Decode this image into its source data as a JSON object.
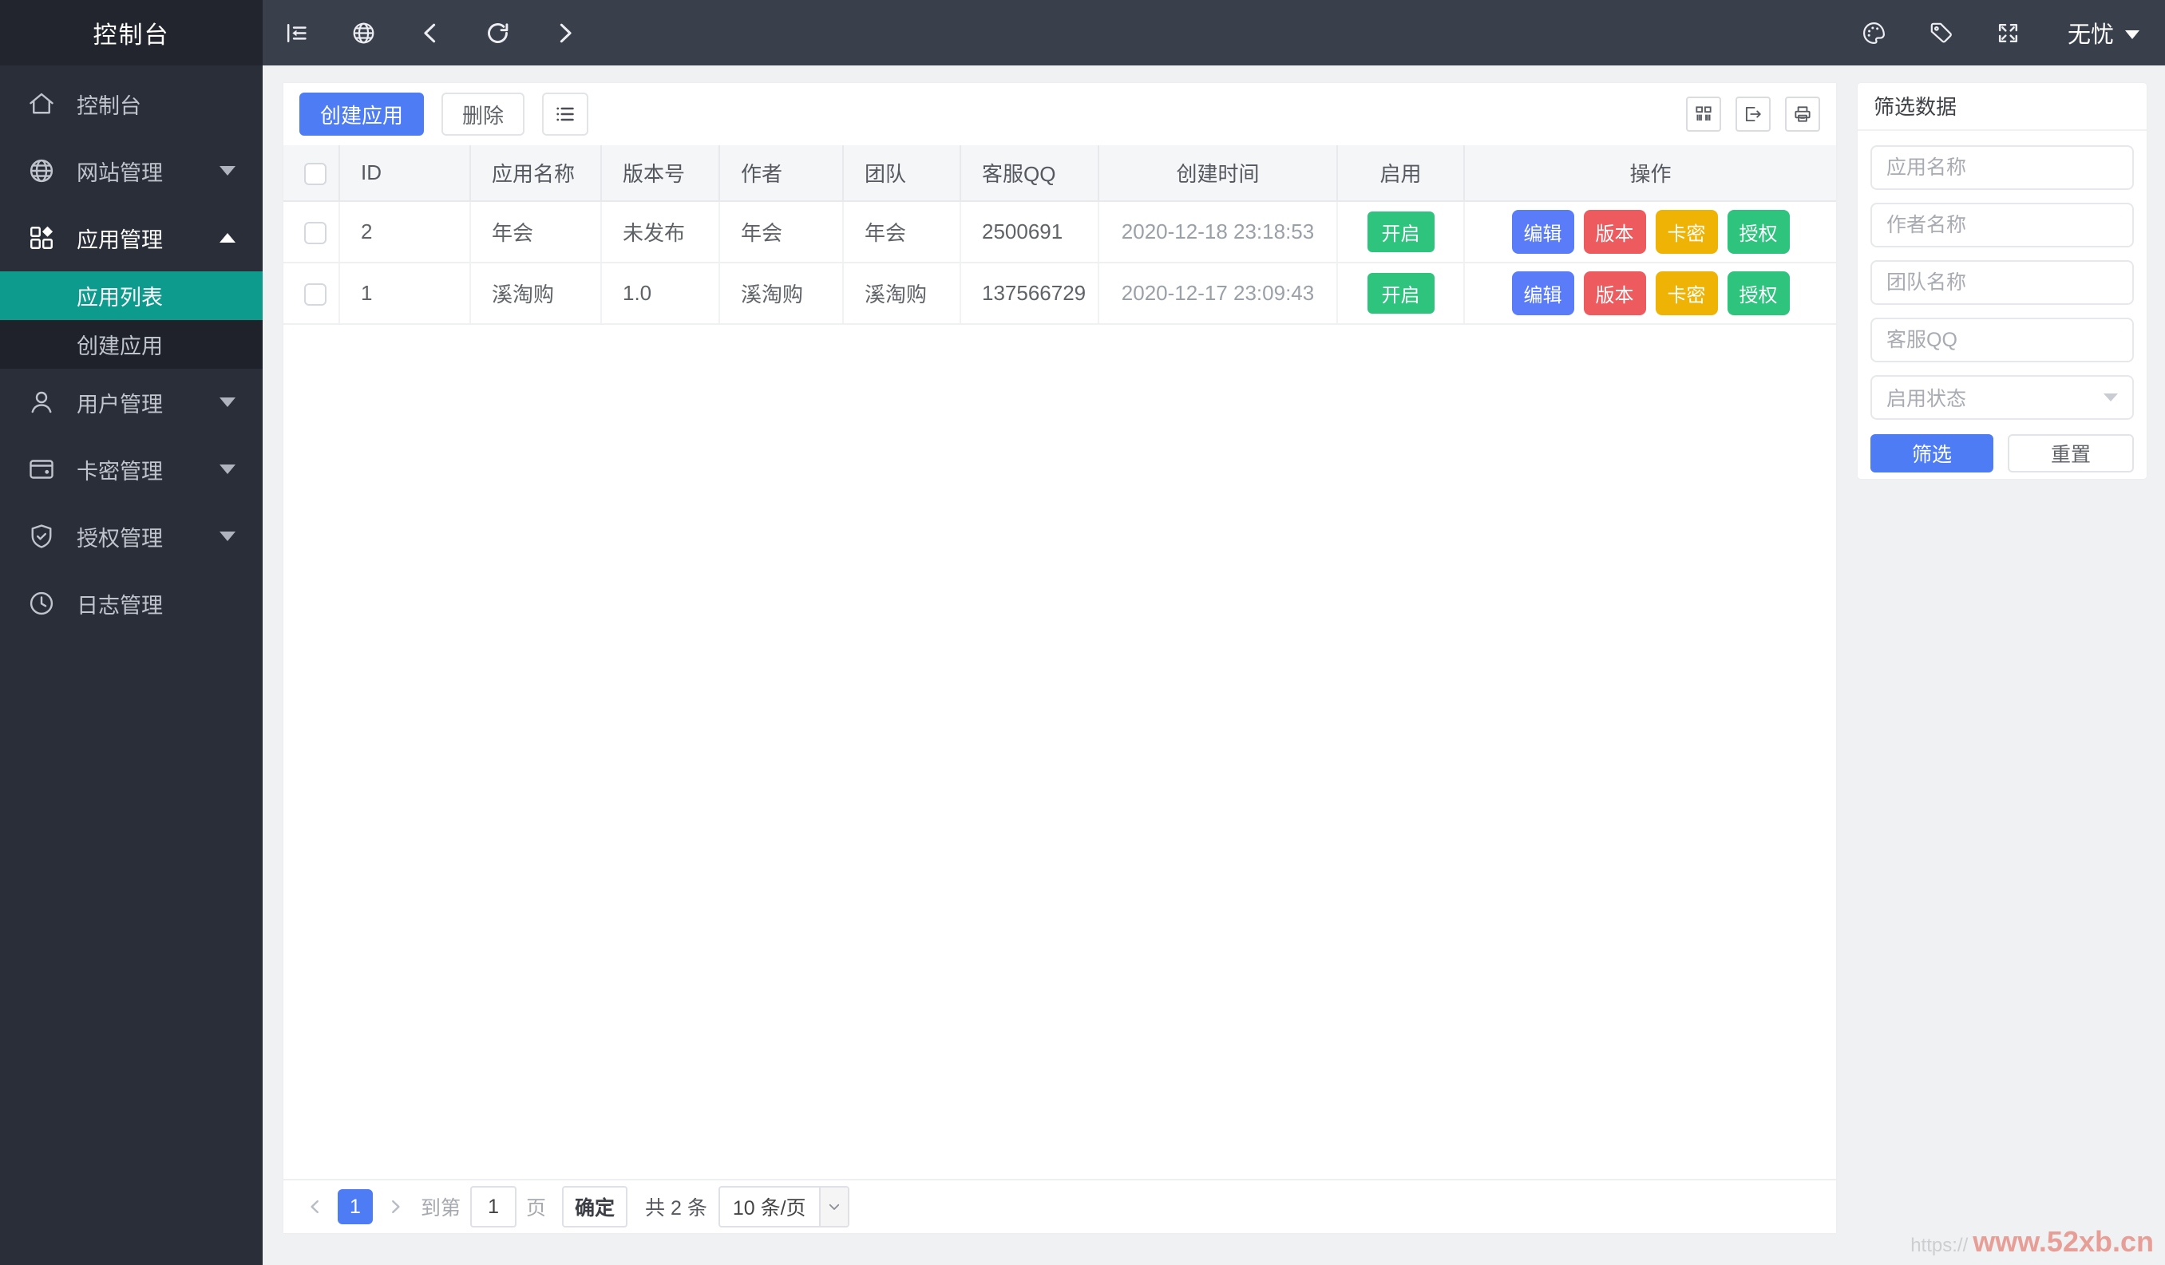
{
  "topbar": {
    "username": "无忧"
  },
  "sidebar": {
    "title": "控制台",
    "items": [
      {
        "key": "dashboard",
        "label": "控制台",
        "icon": "home",
        "arrow": null,
        "active": false
      },
      {
        "key": "website",
        "label": "网站管理",
        "icon": "globe",
        "arrow": "down",
        "active": false
      },
      {
        "key": "apps",
        "label": "应用管理",
        "icon": "apps",
        "arrow": "up",
        "active": true,
        "children": [
          {
            "key": "app-list",
            "label": "应用列表",
            "active": true
          },
          {
            "key": "create-app",
            "label": "创建应用",
            "active": false
          }
        ]
      },
      {
        "key": "users",
        "label": "用户管理",
        "icon": "user",
        "arrow": "down",
        "active": false
      },
      {
        "key": "cards",
        "label": "卡密管理",
        "icon": "card",
        "arrow": "down",
        "active": false
      },
      {
        "key": "auth",
        "label": "授权管理",
        "icon": "shield",
        "arrow": "down",
        "active": false
      },
      {
        "key": "logs",
        "label": "日志管理",
        "icon": "clock",
        "arrow": null,
        "active": false
      }
    ]
  },
  "toolbar": {
    "create_label": "创建应用",
    "delete_label": "删除"
  },
  "table": {
    "headers": [
      "ID",
      "应用名称",
      "版本号",
      "作者",
      "团队",
      "客服QQ",
      "创建时间",
      "启用",
      "操作"
    ],
    "rows": [
      {
        "id": "2",
        "name": "年会",
        "version": "未发布",
        "author": "年会",
        "team": "年会",
        "qq": "2500691",
        "created": "2020-12-18 23:18:53",
        "enabled_label": "开启"
      },
      {
        "id": "1",
        "name": "溪淘购",
        "version": "1.0",
        "author": "溪淘购",
        "team": "溪淘购",
        "qq": "137566729",
        "created": "2020-12-17 23:09:43",
        "enabled_label": "开启"
      }
    ],
    "row_actions": [
      {
        "key": "edit",
        "label": "编辑",
        "color": "#5a7cf8"
      },
      {
        "key": "version",
        "label": "版本",
        "color": "#ee5b5e"
      },
      {
        "key": "card",
        "label": "卡密",
        "color": "#efb306"
      },
      {
        "key": "authorize",
        "label": "授权",
        "color": "#2ec47e"
      }
    ]
  },
  "pagination": {
    "page": "1",
    "goto_prefix": "到第",
    "goto_value": "1",
    "goto_suffix": "页",
    "confirm_label": "确定",
    "total_label": "共 2 条",
    "page_size_label": "10 条/页"
  },
  "filter": {
    "title": "筛选数据",
    "inputs": [
      {
        "key": "app-name",
        "placeholder": "应用名称"
      },
      {
        "key": "author-name",
        "placeholder": "作者名称"
      },
      {
        "key": "team-name",
        "placeholder": "团队名称"
      },
      {
        "key": "service-qq",
        "placeholder": "客服QQ"
      }
    ],
    "select_placeholder": "启用状态",
    "submit_label": "筛选",
    "reset_label": "重置"
  },
  "watermark": {
    "faint": "https://",
    "main": "www.52xb.cn"
  },
  "colors": {
    "accent": "#4e7cf5",
    "menu_active": "#0d9b8d",
    "success": "#2ec47e",
    "danger": "#ee5b5e",
    "warning": "#efb306"
  }
}
